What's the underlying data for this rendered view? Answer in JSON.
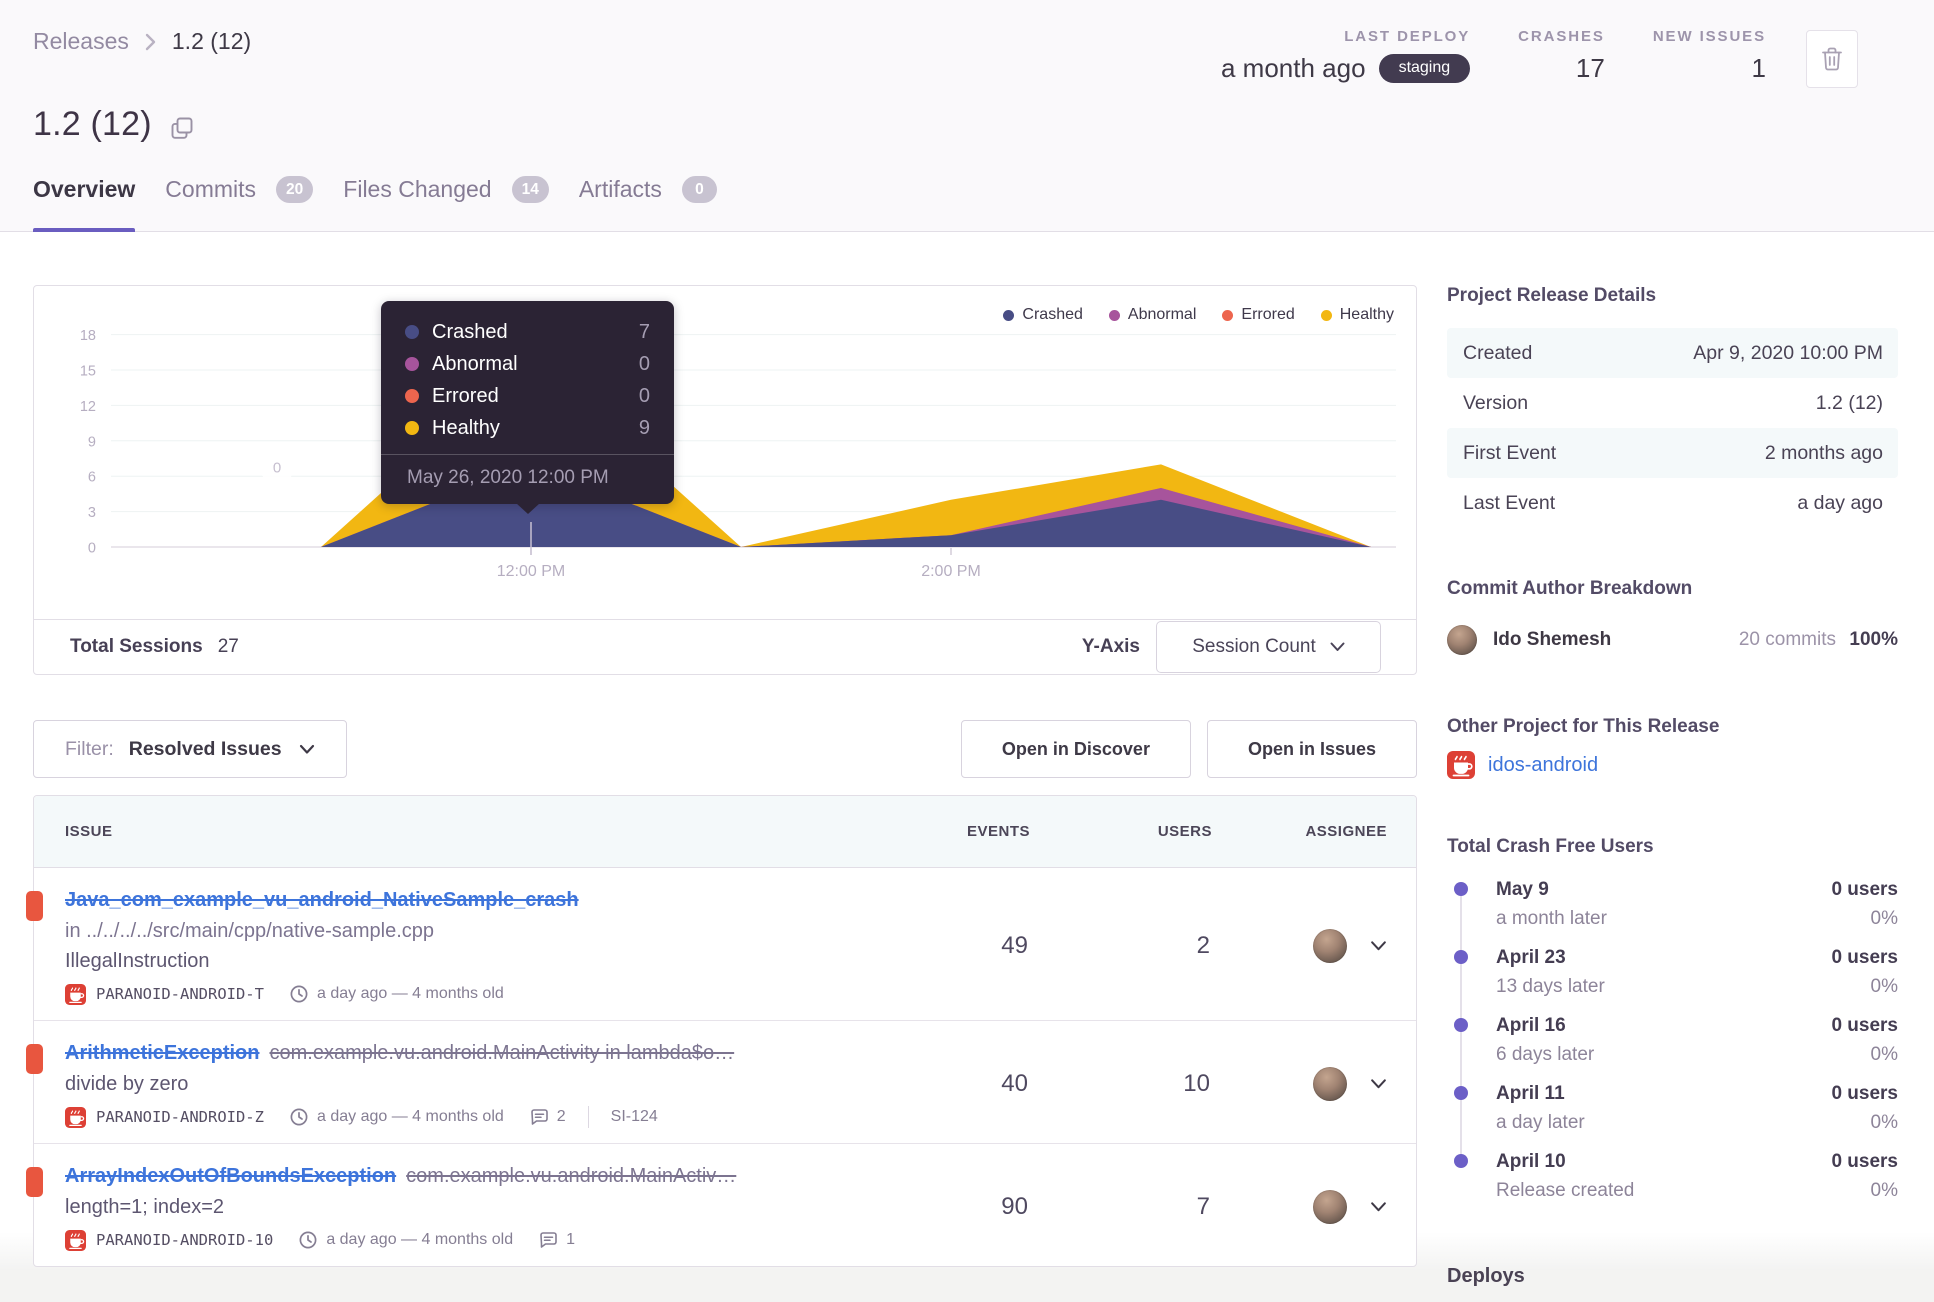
{
  "header": {
    "breadcrumb": {
      "section": "Releases",
      "current": "1.2 (12)"
    },
    "title": "1.2 (12)",
    "tabs": [
      {
        "label": "Overview",
        "badge": null,
        "active": true
      },
      {
        "label": "Commits",
        "badge": "20",
        "active": false
      },
      {
        "label": "Files Changed",
        "badge": "14",
        "active": false
      },
      {
        "label": "Artifacts",
        "badge": "0",
        "active": false
      }
    ],
    "stats": {
      "last_deploy": {
        "label": "LAST DEPLOY",
        "value": "a month ago",
        "env": "staging"
      },
      "crashes": {
        "label": "CRASHES",
        "value": "17"
      },
      "new_issues": {
        "label": "NEW ISSUES",
        "value": "1"
      }
    }
  },
  "chart_data": {
    "type": "area",
    "stacked": true,
    "x": [
      "10:00 AM",
      "11:00 AM",
      "12:00 PM",
      "1:00 PM",
      "2:00 PM",
      "3:00 PM",
      "4:00 PM"
    ],
    "x_tick_labels": [
      "12:00 PM",
      "2:00 PM"
    ],
    "y_ticks": [
      0,
      3,
      6,
      9,
      12,
      15,
      18
    ],
    "ylim": [
      0,
      18
    ],
    "grid": true,
    "legend_position": "top-right",
    "series": [
      {
        "name": "Crashed",
        "color": "#484d85",
        "values": [
          0,
          0,
          7,
          0,
          1,
          4,
          0
        ]
      },
      {
        "name": "Abnormal",
        "color": "#a7549c",
        "values": [
          0,
          0,
          0,
          0,
          0,
          1,
          0
        ]
      },
      {
        "name": "Errored",
        "color": "#ed654e",
        "values": [
          0,
          0,
          0,
          0,
          0,
          0,
          0
        ]
      },
      {
        "name": "Healthy",
        "color": "#f2b712",
        "values": [
          0,
          0,
          9,
          0,
          3,
          2,
          0
        ]
      }
    ],
    "tooltip": {
      "rows": [
        {
          "name": "Crashed",
          "value": "7"
        },
        {
          "name": "Abnormal",
          "value": "0"
        },
        {
          "name": "Errored",
          "value": "0"
        },
        {
          "name": "Healthy",
          "value": "9"
        }
      ],
      "date": "May 26, 2020 12:00 PM"
    },
    "ghost_label": "0"
  },
  "session_panel": {
    "total_label": "Total Sessions",
    "total_value": "27",
    "yaxis_label": "Y-Axis",
    "yaxis_value": "Session Count"
  },
  "filter_bar": {
    "filter_label": "Filter:",
    "filter_value": "Resolved Issues",
    "open_discover": "Open in Discover",
    "open_issues": "Open in Issues"
  },
  "issues_table": {
    "headers": [
      "ISSUE",
      "EVENTS",
      "USERS",
      "ASSIGNEE"
    ],
    "rows": [
      {
        "title": "Java_com_example_vu_android_NativeSample_crash",
        "culprit": null,
        "location": "in ../../../../src/main/cpp/native-sample.cpp",
        "message": "IllegalInstruction",
        "project": "PARANOID-ANDROID-T",
        "age": "a day ago — 4 months old",
        "comments": null,
        "annotation": null,
        "events": "49",
        "users": "2"
      },
      {
        "title": "ArithmeticException",
        "culprit": "com.example.vu.android.MainActivity in lambda$o…",
        "location": null,
        "message": "divide by zero",
        "project": "PARANOID-ANDROID-Z",
        "age": "a day ago — 4 months old",
        "comments": "2",
        "annotation": "SI-124",
        "events": "40",
        "users": "10"
      },
      {
        "title": "ArrayIndexOutOfBoundsException",
        "culprit": "com.example.vu.android.MainActiv…",
        "location": null,
        "message": "length=1; index=2",
        "project": "PARANOID-ANDROID-10",
        "age": "a day ago — 4 months old",
        "comments": "1",
        "annotation": null,
        "events": "90",
        "users": "7"
      }
    ]
  },
  "sidebar": {
    "details": {
      "heading": "Project Release Details",
      "rows": [
        {
          "key": "Created",
          "value": "Apr 9, 2020 10:00 PM"
        },
        {
          "key": "Version",
          "value": "1.2 (12)"
        },
        {
          "key": "First Event",
          "value": "2 months ago"
        },
        {
          "key": "Last Event",
          "value": "a day ago"
        }
      ]
    },
    "authors": {
      "heading": "Commit Author Breakdown",
      "name": "Ido Shemesh",
      "commits": "20 commits",
      "percent": "100%"
    },
    "other_project": {
      "heading": "Other Project for This Release",
      "project": "idos-android"
    },
    "crash_free": {
      "heading": "Total Crash Free Users",
      "entries": [
        {
          "date": "May 9",
          "detail": "a month later",
          "users": "0 users",
          "percent": "0%"
        },
        {
          "date": "April 23",
          "detail": "13 days later",
          "users": "0 users",
          "percent": "0%"
        },
        {
          "date": "April 16",
          "detail": "6 days later",
          "users": "0 users",
          "percent": "0%"
        },
        {
          "date": "April 11",
          "detail": "a day later",
          "users": "0 users",
          "percent": "0%"
        },
        {
          "date": "April 10",
          "detail": "Release created",
          "users": "0 users",
          "percent": "0%"
        }
      ]
    },
    "deploys_heading": "Deploys"
  },
  "colors": {
    "accent_purple": "#6a5dc0",
    "link_blue": "#3d74db",
    "error_red": "#e8563f",
    "crashed": "#484d85",
    "abnormal": "#a7549c",
    "errored": "#ed654e",
    "healthy": "#f2b712",
    "tooltip_bg": "#2a2433",
    "header_bg": "#faf9fb",
    "stripe_bg": "#f4f9fa",
    "border": "#e2dee6"
  }
}
